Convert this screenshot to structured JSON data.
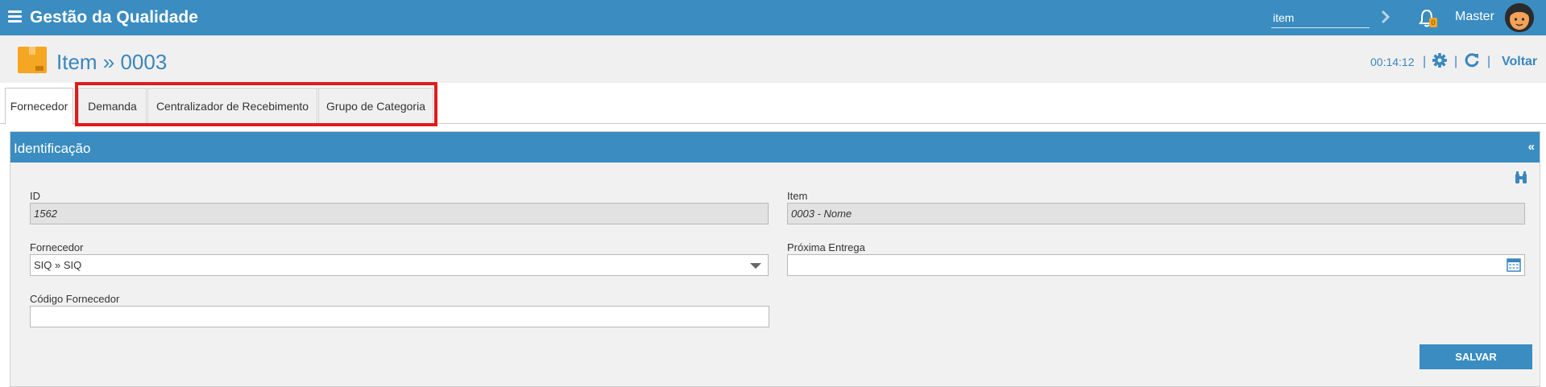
{
  "app": {
    "title": "Gestão da Qualidade"
  },
  "topbar": {
    "search_value": "item",
    "notification_count": "0",
    "user_name": "Master"
  },
  "header": {
    "title": "Item » 0003",
    "timer": "00:14:12",
    "back_label": "Voltar"
  },
  "tabs": [
    {
      "label": "Fornecedor",
      "active": true
    },
    {
      "label": "Demanda",
      "active": false
    },
    {
      "label": "Centralizador de Recebimento",
      "active": false
    },
    {
      "label": "Grupo de Categoria",
      "active": false
    }
  ],
  "highlight_color": "#e11b1b",
  "panel": {
    "title": "Identificação",
    "collapse_symbol": "«"
  },
  "form": {
    "id": {
      "label": "ID",
      "value": "1562"
    },
    "item": {
      "label": "Item",
      "value": "0003 - Nome"
    },
    "fornecedor": {
      "label": "Fornecedor",
      "value": "SIQ  »  SIQ"
    },
    "proxima_entrega": {
      "label": "Próxima Entrega",
      "value": ""
    },
    "codigo_fornecedor": {
      "label": "Código Fornecedor",
      "value": ""
    },
    "save_label": "SALVAR"
  },
  "colors": {
    "primary": "#3a8cc1",
    "accent_orange": "#f5a623"
  }
}
